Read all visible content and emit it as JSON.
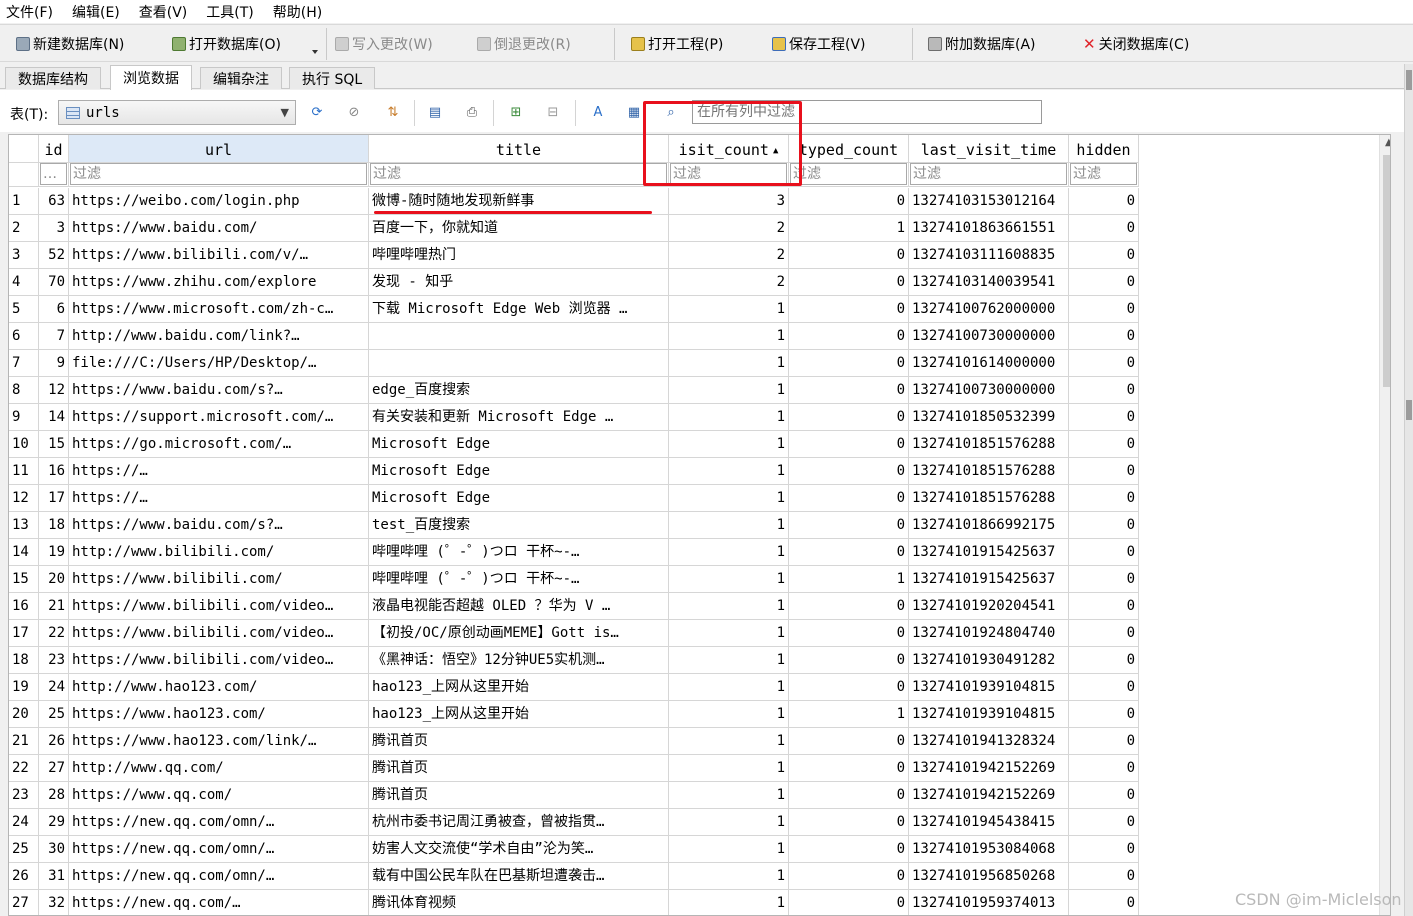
{
  "menu": [
    "文件(F)",
    "编辑(E)",
    "查看(V)",
    "工具(T)",
    "帮助(H)"
  ],
  "toolbar": {
    "new_db": "新建数据库(N)",
    "open_db": "打开数据库(O)",
    "write_changes": "写入更改(W)",
    "revert_changes": "倒退更改(R)",
    "open_project": "打开工程(P)",
    "save_project": "保存工程(V)",
    "attach_db": "附加数据库(A)",
    "close_db": "关闭数据库(C)"
  },
  "tabs": [
    "数据库结构",
    "浏览数据",
    "编辑杂注",
    "执行 SQL"
  ],
  "active_tab": "浏览数据",
  "table_selector": {
    "label": "表(T):",
    "value": "urls"
  },
  "global_filter_placeholder": "在所有列中过滤",
  "grid": {
    "columns": [
      "id",
      "url",
      "title",
      "isit_count",
      "typed_count",
      "last_visit_time",
      "hidden"
    ],
    "sorted_column": "isit_count",
    "filter_placeholder": "过滤",
    "id_filter_placeholder": "…",
    "rows": [
      [
        "1",
        "63",
        "https://weibo.com/login.php",
        "微博-随时随地发现新鲜事",
        "3",
        "0",
        "13274103153012164",
        "0"
      ],
      [
        "2",
        "3",
        "https://www.baidu.com/",
        "百度一下，你就知道",
        "2",
        "1",
        "13274101863661551",
        "0"
      ],
      [
        "3",
        "52",
        "https://www.bilibili.com/v/…",
        "哔哩哔哩热门",
        "2",
        "0",
        "13274103111608835",
        "0"
      ],
      [
        "4",
        "70",
        "https://www.zhihu.com/explore",
        "发现 - 知乎",
        "2",
        "0",
        "13274103140039541",
        "0"
      ],
      [
        "5",
        "6",
        "https://www.microsoft.com/zh-c…",
        "下载 Microsoft Edge Web 浏览器 …",
        "1",
        "0",
        "13274100762000000",
        "0"
      ],
      [
        "6",
        "7",
        "http://www.baidu.com/link?…",
        "",
        "1",
        "0",
        "13274100730000000",
        "0"
      ],
      [
        "7",
        "9",
        "file:///C:/Users/HP/Desktop/…",
        "",
        "1",
        "0",
        "13274101614000000",
        "0"
      ],
      [
        "8",
        "12",
        "https://www.baidu.com/s?…",
        "edge_百度搜索",
        "1",
        "0",
        "13274100730000000",
        "0"
      ],
      [
        "9",
        "14",
        "https://support.microsoft.com/…",
        "有关安装和更新 Microsoft Edge …",
        "1",
        "0",
        "13274101850532399",
        "0"
      ],
      [
        "10",
        "15",
        "https://go.microsoft.com/…",
        "Microsoft Edge",
        "1",
        "0",
        "13274101851576288",
        "0"
      ],
      [
        "11",
        "16",
        "https://…",
        "Microsoft Edge",
        "1",
        "0",
        "13274101851576288",
        "0"
      ],
      [
        "12",
        "17",
        "https://…",
        "Microsoft Edge",
        "1",
        "0",
        "13274101851576288",
        "0"
      ],
      [
        "13",
        "18",
        "https://www.baidu.com/s?…",
        "test_百度搜索",
        "1",
        "0",
        "13274101866992175",
        "0"
      ],
      [
        "14",
        "19",
        "http://www.bilibili.com/",
        "哔哩哔哩 (゜-゜)つロ 干杯~-…",
        "1",
        "0",
        "13274101915425637",
        "0"
      ],
      [
        "15",
        "20",
        "https://www.bilibili.com/",
        "哔哩哔哩 (゜-゜)つロ 干杯~-…",
        "1",
        "1",
        "13274101915425637",
        "0"
      ],
      [
        "16",
        "21",
        "https://www.bilibili.com/video…",
        "液晶电视能否超越 OLED ？华为 V …",
        "1",
        "0",
        "13274101920204541",
        "0"
      ],
      [
        "17",
        "22",
        "https://www.bilibili.com/video…",
        "【初投/OC/原创动画MEME】Gott is…",
        "1",
        "0",
        "13274101924804740",
        "0"
      ],
      [
        "18",
        "23",
        "https://www.bilibili.com/video…",
        "《黑神话：悟空》12分钟UE5实机测…",
        "1",
        "0",
        "13274101930491282",
        "0"
      ],
      [
        "19",
        "24",
        "http://www.hao123.com/",
        "hao123_上网从这里开始",
        "1",
        "0",
        "13274101939104815",
        "0"
      ],
      [
        "20",
        "25",
        "https://www.hao123.com/",
        "hao123_上网从这里开始",
        "1",
        "1",
        "13274101939104815",
        "0"
      ],
      [
        "21",
        "26",
        "https://www.hao123.com/link/…",
        "腾讯首页",
        "1",
        "0",
        "13274101941328324",
        "0"
      ],
      [
        "22",
        "27",
        "http://www.qq.com/",
        "腾讯首页",
        "1",
        "0",
        "13274101942152269",
        "0"
      ],
      [
        "23",
        "28",
        "https://www.qq.com/",
        "腾讯首页",
        "1",
        "0",
        "13274101942152269",
        "0"
      ],
      [
        "24",
        "29",
        "https://new.qq.com/omn/…",
        "杭州市委书记周江勇被查，曾被指贯…",
        "1",
        "0",
        "13274101945438415",
        "0"
      ],
      [
        "25",
        "30",
        "https://new.qq.com/omn/…",
        "妨害人文交流使“学术自由”沦为笑…",
        "1",
        "0",
        "13274101953084068",
        "0"
      ],
      [
        "26",
        "31",
        "https://new.qq.com/omn/…",
        "载有中国公民车队在巴基斯坦遭袭击…",
        "1",
        "0",
        "13274101956850268",
        "0"
      ],
      [
        "27",
        "32",
        "https://new.qq.com/…",
        "腾讯体育视频",
        "1",
        "0",
        "13274101959374013",
        "0"
      ]
    ]
  },
  "watermark": "CSDN @im-Miclelson",
  "colors": {
    "annotation_red": "#e8101c",
    "sorted_header_bg": "#dde9f7"
  }
}
